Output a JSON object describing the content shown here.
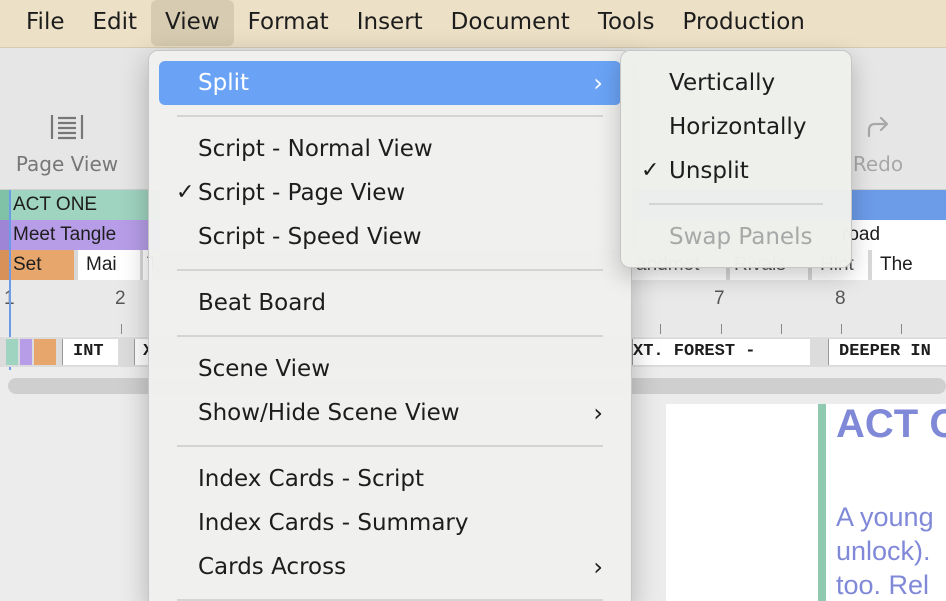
{
  "menubar": {
    "items": [
      "File",
      "Edit",
      "View",
      "Format",
      "Insert",
      "Document",
      "Tools",
      "Production"
    ],
    "active_index": 2
  },
  "toolbar": {
    "page_view_label": "Page View",
    "redo_label": "Redo"
  },
  "timeline": {
    "act_row": {
      "label": "ACT ONE",
      "color": "#9fd4c0"
    },
    "beat_row": {
      "label": "Meet Tangle",
      "right_label": "road",
      "color": "#b79de8"
    },
    "detail_row": [
      "Set",
      "Mai",
      "T",
      "andmot",
      "Rivals",
      "Hint",
      "The"
    ],
    "ruler_numbers": [
      "1",
      "2",
      "7",
      "8"
    ],
    "scenes": [
      "INT",
      "X",
      "XT. FOREST -",
      "DEEPER IN"
    ]
  },
  "script_page": {
    "title": "ACT O",
    "lines": [
      "A young",
      "unlock).",
      "too. Rel"
    ]
  },
  "view_menu": {
    "items": [
      {
        "label": "Split",
        "has_submenu": true,
        "highlighted": true
      },
      {
        "label": "Script - Normal View"
      },
      {
        "label": "Script - Page View",
        "checked": true
      },
      {
        "label": "Script - Speed View"
      },
      {
        "label": "Beat Board"
      },
      {
        "label": "Scene View"
      },
      {
        "label": "Show/Hide Scene View",
        "has_submenu": true
      },
      {
        "label": "Index Cards - Script"
      },
      {
        "label": "Index Cards - Summary"
      },
      {
        "label": "Cards Across",
        "has_submenu": true
      }
    ]
  },
  "split_submenu": {
    "items": [
      {
        "label": "Vertically"
      },
      {
        "label": "Horizontally"
      },
      {
        "label": "Unsplit",
        "checked": true
      },
      {
        "label": "Swap Panels",
        "disabled": true
      }
    ]
  },
  "colors": {
    "highlight": "#6aa3f5",
    "menubar": "#ece0c6",
    "act_row": "#9fd4c0",
    "beat_row": "#b79de8",
    "set_chip": "#e6a66c",
    "page_text": "#8089d8",
    "timeline_blue": "#6c9be8"
  }
}
